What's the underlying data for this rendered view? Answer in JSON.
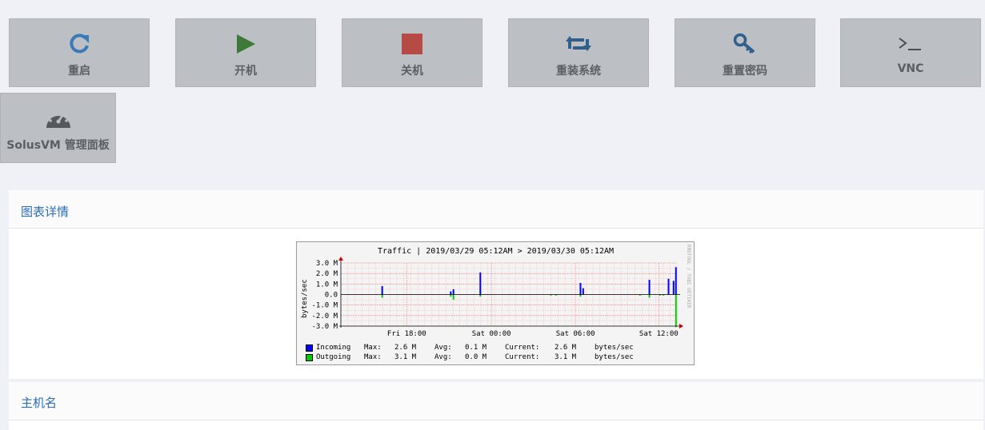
{
  "actions": [
    {
      "label": "重启",
      "icon": "refresh-icon"
    },
    {
      "label": "开机",
      "icon": "play-icon"
    },
    {
      "label": "关机",
      "icon": "stop-icon"
    },
    {
      "label": "重装系统",
      "icon": "retweet-icon"
    },
    {
      "label": "重置密码",
      "icon": "key-icon"
    },
    {
      "label": "VNC",
      "icon": "terminal-icon"
    },
    {
      "label": "SolusVM 管理面板",
      "icon": "dashboard-icon"
    }
  ],
  "colors": {
    "refresh": "#3b7ab8",
    "play": "#3d7a37",
    "stop": "#b64a45",
    "accent": "#2a6db5"
  },
  "panels": {
    "graph_title": "图表详情",
    "hostname_title": "主机名"
  },
  "chart_data": {
    "type": "bar",
    "title": "Traffic | 2019/03/29 05:12AM > 2019/03/30 05:12AM",
    "ylabel": "bytes/sec",
    "ylim": [
      -3.0,
      3.0
    ],
    "yticks": [
      "3.0 M",
      "2.0 M",
      "1.0 M",
      "0.0",
      "-1.0 M",
      "-2.0 M",
      "-3.0 M"
    ],
    "xticks": [
      "Fri 18:00",
      "Sat 00:00",
      "Sat 06:00",
      "Sat 12:00"
    ],
    "watermark": "RRDTOOL / TOBI OETIKER",
    "series": [
      {
        "name": "Incoming",
        "color": "#0000ff",
        "points": [
          [
            0.123,
            0.8
          ],
          [
            0.327,
            0.3
          ],
          [
            0.335,
            0.5
          ],
          [
            0.415,
            2.1
          ],
          [
            0.713,
            1.1
          ],
          [
            0.721,
            0.6
          ],
          [
            0.918,
            1.4
          ],
          [
            0.975,
            1.5
          ],
          [
            0.99,
            1.3
          ],
          [
            0.997,
            2.6
          ]
        ]
      },
      {
        "name": "Outgoing",
        "color": "#00cc00",
        "points": [
          [
            0.123,
            -0.3
          ],
          [
            0.327,
            -0.2
          ],
          [
            0.335,
            -0.5
          ],
          [
            0.415,
            -0.2
          ],
          [
            0.625,
            -0.1
          ],
          [
            0.64,
            -0.1
          ],
          [
            0.713,
            -0.2
          ],
          [
            0.89,
            -0.1
          ],
          [
            0.918,
            -0.3
          ],
          [
            0.95,
            -0.1
          ],
          [
            0.96,
            -0.1
          ],
          [
            0.997,
            -3.1
          ]
        ]
      }
    ],
    "legend": [
      {
        "name": "Incoming",
        "max": "Max:",
        "max_val": "2.6 M",
        "avg": "Avg:",
        "avg_val": "0.1 M",
        "cur": "Current:",
        "cur_val": "2.6 M",
        "unit": "bytes/sec"
      },
      {
        "name": "Outgoing",
        "max": "Max:",
        "max_val": "3.1 M",
        "avg": "Avg:",
        "avg_val": "0.0 M",
        "cur": "Current:",
        "cur_val": "3.1 M",
        "unit": "bytes/sec"
      }
    ]
  }
}
